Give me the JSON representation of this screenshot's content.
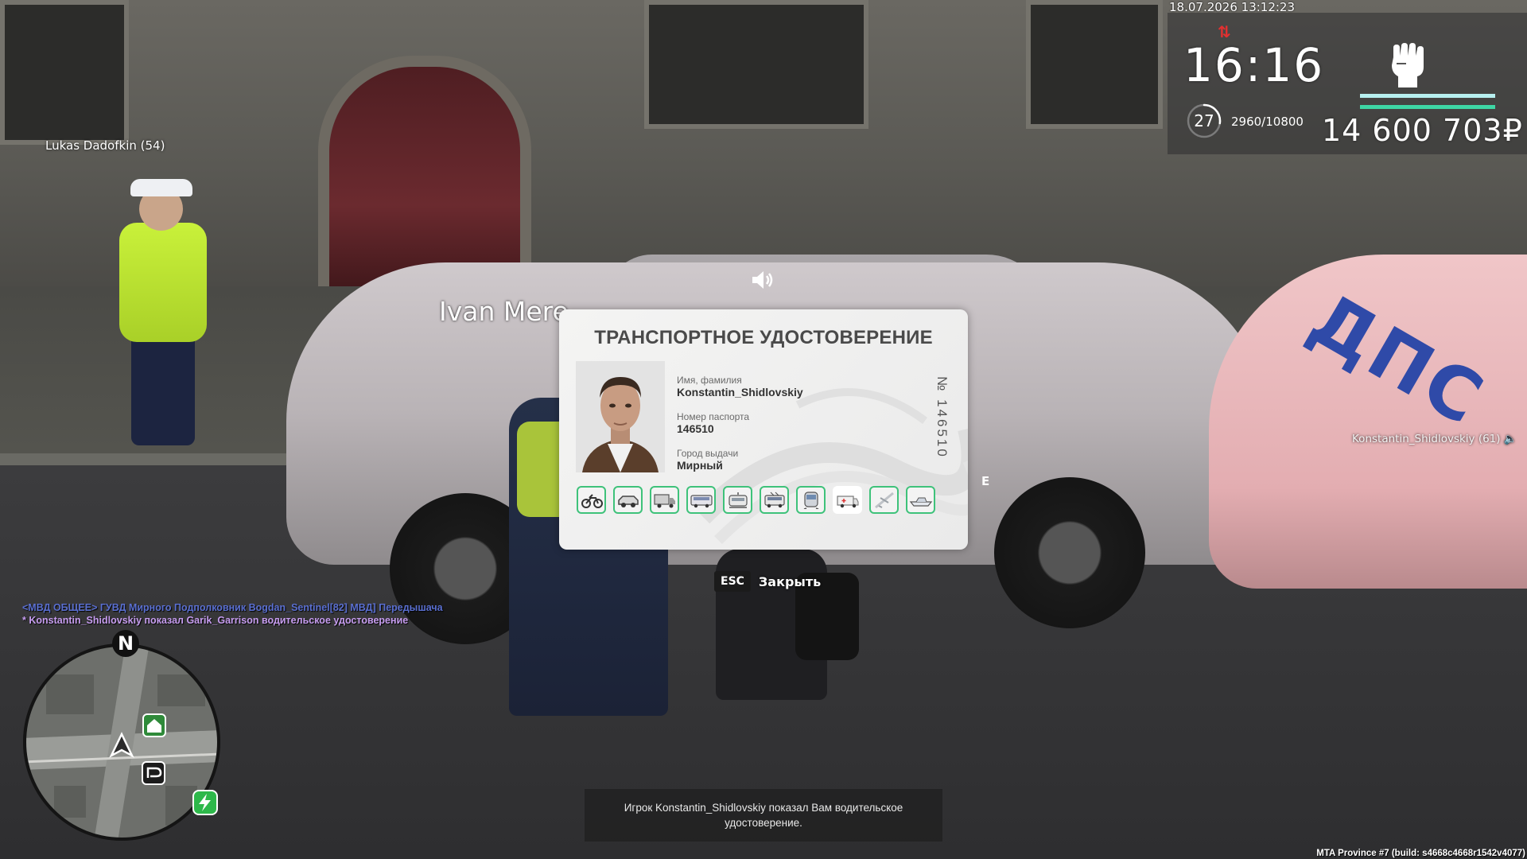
{
  "hud": {
    "datetime": "18.07.2026 13:12:23",
    "clock": "16:16",
    "level": "27",
    "xp": "2960/10800",
    "level_progress": 0.274,
    "money": "14 600 703₽",
    "signal_icon": "signal-arrows-icon",
    "faction_icon": "fist-icon",
    "bar_colors": [
      "#b7f0ef",
      "#3ed6a4"
    ]
  },
  "nametags": {
    "player_left": "Lukas Dadofkin (54)",
    "player_center": "Ivan Mere",
    "player_right": "Konstantin_Shidlovskiy (61)"
  },
  "scene": {
    "dps_label": "ДПС",
    "car_plate_letter": "E"
  },
  "license": {
    "title": "ТРАНСПОРТНОЕ УДОСТОВЕРЕНИЕ",
    "name_label": "Имя, фамилия",
    "name_value": "Konstantin_Shidlovskiy",
    "passport_label": "Номер паспорта",
    "passport_value": "146510",
    "city_label": "Город выдачи",
    "city_value": "Мирный",
    "number": "№ 146510",
    "categories": [
      {
        "icon": "motorcycle-icon",
        "active": true
      },
      {
        "icon": "car-icon",
        "active": true
      },
      {
        "icon": "truck-icon",
        "active": true
      },
      {
        "icon": "bus-icon",
        "active": true
      },
      {
        "icon": "tram-icon",
        "active": true
      },
      {
        "icon": "trolleybus-icon",
        "active": true
      },
      {
        "icon": "train-icon",
        "active": true
      },
      {
        "icon": "ambulance-icon",
        "active": false
      },
      {
        "icon": "airplane-icon",
        "active": true
      },
      {
        "icon": "boat-icon",
        "active": true
      }
    ],
    "accent_color": "#3ec27a"
  },
  "close_hint": {
    "key": "ESC",
    "label": "Закрыть"
  },
  "chat": [
    {
      "text": "<МВД ОБЩЕЕ> ГУВД Мирного Подполковник Bogdan_Sentinel[82] МВД] Передышача",
      "color": "#5a6fd0"
    },
    {
      "text": "* Konstantin_Shidlovskiy показал Garik_Garrison водительское удостоверение",
      "color": "#c79df0"
    }
  ],
  "minimap": {
    "north_label": "N"
  },
  "notification": {
    "text": "Игрок Konstantin_Shidlovskiy показал Вам водительское удостоверение."
  },
  "build_info": "MTA Province #7 (build: s4668c4668r1542v4077)"
}
